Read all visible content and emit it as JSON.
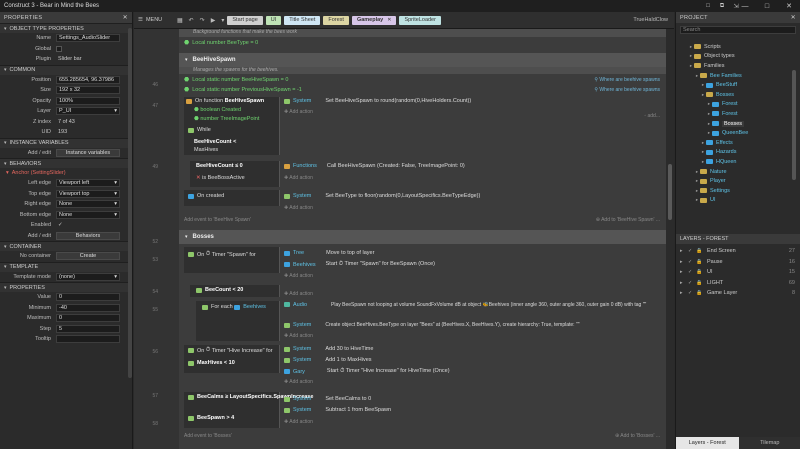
{
  "window": {
    "title": "Construct 3 - Bear in Mind the Bees",
    "ctrls": [
      "□",
      "⧉",
      "⇲",
      "—",
      "□",
      "✕"
    ]
  },
  "toolbar": {
    "menu_label": "MENU",
    "tabs": [
      {
        "label": "Start page"
      },
      {
        "label": "UI"
      },
      {
        "label": "Title Sheet"
      },
      {
        "label": "Forest"
      },
      {
        "label": "Gameplay",
        "close": "✕"
      },
      {
        "label": "SpriteLoader"
      }
    ],
    "user": "TrueHaldClow"
  },
  "properties": {
    "title": "PROPERTIES",
    "sections": {
      "object_type": "OBJECT TYPE PROPERTIES",
      "common": "COMMON",
      "instance_vars": "INSTANCE VARIABLES",
      "behaviors": "BEHAVIORS",
      "container": "CONTAINER",
      "template": "TEMPLATE",
      "props": "PROPERTIES"
    },
    "name": {
      "label": "Name",
      "value": "Settings_AudioSlider"
    },
    "global": {
      "label": "Global"
    },
    "plugin": {
      "label": "Plugin",
      "value": "Slider bar"
    },
    "position": {
      "label": "Position",
      "value": "655.285654, 96.37986"
    },
    "size": {
      "label": "Size",
      "value": "192 x 32"
    },
    "opacity": {
      "label": "Opacity",
      "value": "100%"
    },
    "layer": {
      "label": "Layer",
      "value": "P_UI"
    },
    "zindex": {
      "label": "Z index",
      "value": "7 of 43"
    },
    "uid": {
      "label": "UID",
      "value": "193"
    },
    "iv_add": {
      "label": "Add / edit",
      "value": "Instance variables"
    },
    "behavior_item": "Anchor (SettingSlider)",
    "left_edge": {
      "label": "Left edge",
      "value": "Viewport left"
    },
    "top_edge": {
      "label": "Top edge",
      "value": "Viewport top"
    },
    "right_edge": {
      "label": "Right edge",
      "value": "None"
    },
    "bottom_edge": {
      "label": "Bottom edge",
      "value": "None"
    },
    "enabled": {
      "label": "Enabled",
      "value": "✓"
    },
    "beh_add": {
      "label": "Add / edit",
      "value": "Behaviors"
    },
    "container": {
      "label": "No container",
      "value": "Create"
    },
    "template_mode": {
      "label": "Template mode",
      "value": "(none)"
    },
    "value": {
      "label": "Value",
      "value": "0"
    },
    "minimum": {
      "label": "Minimum",
      "value": "-40"
    },
    "maximum": {
      "label": "Maximum",
      "value": "0"
    },
    "step": {
      "label": "Step",
      "value": "5"
    },
    "tooltip": {
      "label": "Tooltip",
      "value": ""
    }
  },
  "project": {
    "title": "PROJECT",
    "search_placeholder": "Search",
    "items": [
      {
        "label": "Scripts",
        "type": "folder",
        "indent": 2
      },
      {
        "label": "Object types",
        "type": "folder",
        "indent": 2
      },
      {
        "label": "Families",
        "type": "folder",
        "indent": 2
      },
      {
        "label": "Bee Families",
        "type": "folder",
        "indent": 3,
        "cyan": true
      },
      {
        "label": "BeeStuff",
        "type": "obj",
        "indent": 4,
        "cyan": true
      },
      {
        "label": "Bosses",
        "type": "folder",
        "indent": 4,
        "cyan": true
      },
      {
        "label": "Forest",
        "type": "obj",
        "indent": 5,
        "cyan": true
      },
      {
        "label": "Forest",
        "type": "obj",
        "indent": 5,
        "cyan": true
      },
      {
        "label": "Bosses",
        "type": "obj",
        "indent": 5,
        "selected": true
      },
      {
        "label": "QueenBee",
        "type": "obj",
        "indent": 5,
        "cyan": true
      },
      {
        "label": "Effects",
        "type": "obj",
        "indent": 4,
        "cyan": true
      },
      {
        "label": "Hazards",
        "type": "obj",
        "indent": 4,
        "cyan": true
      },
      {
        "label": "HQueen",
        "type": "obj",
        "indent": 4,
        "cyan": true
      },
      {
        "label": "Nature",
        "type": "folder",
        "indent": 3,
        "cyan": true
      },
      {
        "label": "Player",
        "type": "folder",
        "indent": 3,
        "cyan": true
      },
      {
        "label": "Settings",
        "type": "folder",
        "indent": 3,
        "cyan": true
      },
      {
        "label": "UI",
        "type": "folder",
        "indent": 3,
        "cyan": true
      }
    ]
  },
  "layers": {
    "title": "LAYERS - FOREST",
    "items": [
      {
        "label": "End Screen",
        "num": "27"
      },
      {
        "label": "Pause",
        "num": "16"
      },
      {
        "label": "UI",
        "num": "15"
      },
      {
        "label": "LIGHT",
        "num": "69"
      },
      {
        "label": "Game Layer",
        "num": "8"
      }
    ],
    "tabs": [
      "Layers - Forest",
      "Tilemap"
    ]
  },
  "sheet": {
    "top_comment": "Background functions that make the bees work",
    "local_bee_type": "Local number BeeType = 0",
    "grp1_title": "BeeHiveSpawn",
    "grp1_sub": "Manages the spawns for the beehives.",
    "lv1": "Local static number BeeHiveSpawn = 0",
    "lv2": "Local static number PreviousHiveSpawn = -1",
    "where_hint": "⚲ Where are beehive spawns",
    "fn_on": "On function",
    "fn_name": "BeeHiveSpawn",
    "p1": "boolean Created",
    "p2": "number TreeImagePoint",
    "while": "While",
    "c_count": "BeeHiveCount <",
    "c_max": "MaxHives",
    "c_bool": "is BeeBossActive",
    "c_count2": "BeeHiveCount ≤ 0",
    "on_created": "On created",
    "a1_obj": "System",
    "a1": "Set BeeHiveSpawn to round(random(0,HiveHolders.Count))",
    "a2_obj": "Functions",
    "a2": "Call BeeHiveSpawn (Created: False, TreeImagePoint: 0)",
    "a3_obj": "System",
    "a3": "Set BeeType to floor(random(0,LayoutSpecifics.BeeTypeEdge))",
    "add_action": "✚ Add action",
    "add_event": "Add event to 'BeeHive Spawn'",
    "add_event_r": "⊕ Add to 'BeeHive Spawn' ...",
    "grp2_title": "Bosses",
    "on_timer": "On",
    "timer_spawn": "Timer \"Spawn\" for",
    "tree": "Tree",
    "beehives": "Beehives",
    "a4": "Move to top of layer",
    "a5": "Start ⏱ Timer \"Spawn\" for BeeSpawn (Once)",
    "beecount": "BeeCount < 20",
    "foreach": "For each",
    "audio": "Audio",
    "a6": "Play BeeSpawn not looping at volume SoundFxVolume dB at object 🐝Beehives (inner angle 360, outer angle 360, outer gain 0 dB) with tag \"\"",
    "a7": "Create object BeeHives.BeeType on layer \"Bees\" at (BeeHives.X, BeeHives.Y), create hierarchy: True, template: \"\"",
    "timer_hive": "Timer \"Hive Increase\" for",
    "maxhives": "MaxHives < 10",
    "a8": "Add 30 to HiveTime",
    "a9": "Add 1 to MaxHives",
    "gary": "Gary",
    "a10": "Start ⏱ Timer \"Hive Increase\" for HiveTime (Once)",
    "beecalms": "BeeCalms ≥ LayoutSpecifics.SpawnIncrease",
    "beespawn4": "BeeSpawn > 4",
    "a11": "Set BeeCalms to 0",
    "a12": "Subtract 1 from BeeSpawn",
    "add_event2": "Add event to 'Bosses'",
    "add_event2_r": "⊕ Add to 'Bosses' ...",
    "line_numbers": [
      "46",
      "47",
      "49",
      "52",
      "53",
      "54",
      "55",
      "56",
      "57",
      "58"
    ]
  }
}
